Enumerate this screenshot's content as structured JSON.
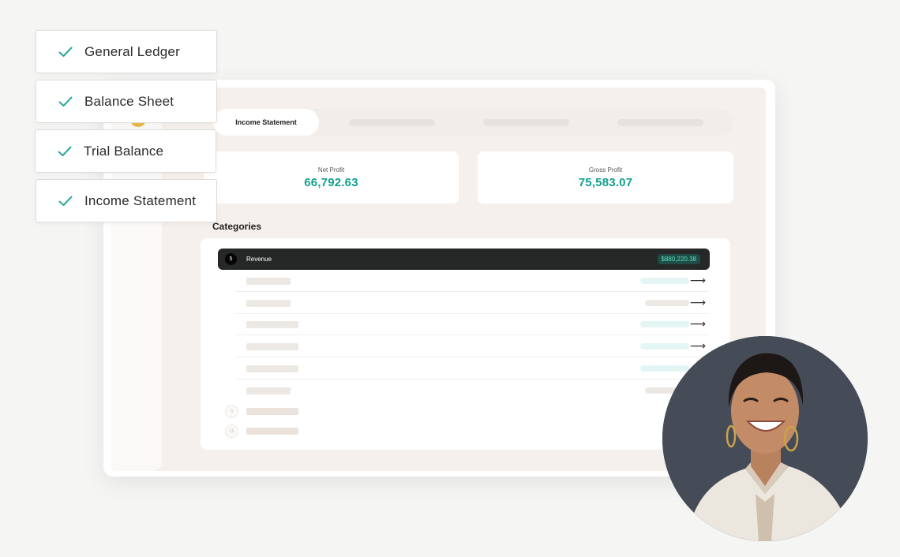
{
  "checklist": [
    {
      "label": "General Ledger"
    },
    {
      "label": "Balance Sheet"
    },
    {
      "label": "Trial Balance"
    },
    {
      "label": "Income Statement"
    }
  ],
  "tabs": {
    "active_label": "Income Statement"
  },
  "stats": {
    "net_profit": {
      "label": "Net Profit",
      "value": "66,792.63"
    },
    "gross_profit": {
      "label": "Gross Profit",
      "value": "75,583.07"
    }
  },
  "categories": {
    "title": "Categories",
    "revenue": {
      "count": "5",
      "label": "Revenue",
      "amount": "$880,220.38"
    },
    "sub_counts": [
      "5",
      "15"
    ]
  },
  "colors": {
    "accent": "#12a08e",
    "check": "#2aa79a",
    "dark_row": "#262727",
    "portrait_bg": "#454b57"
  },
  "icons": {
    "check": "check-icon",
    "arrow": "arrow-right-icon"
  }
}
